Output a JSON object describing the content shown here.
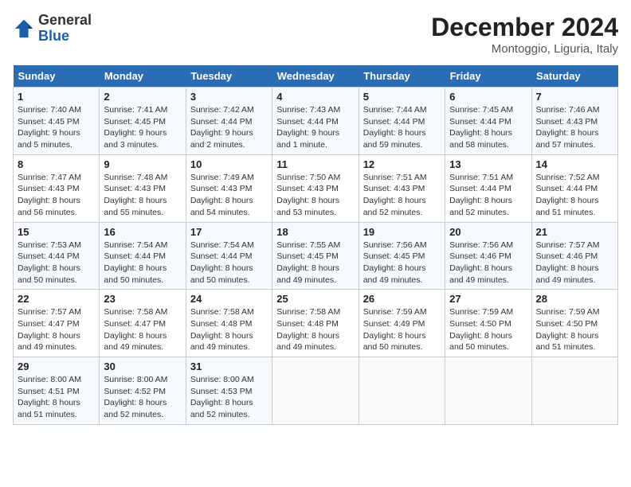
{
  "header": {
    "logo_general": "General",
    "logo_blue": "Blue",
    "month_title": "December 2024",
    "location": "Montoggio, Liguria, Italy"
  },
  "days_of_week": [
    "Sunday",
    "Monday",
    "Tuesday",
    "Wednesday",
    "Thursday",
    "Friday",
    "Saturday"
  ],
  "weeks": [
    [
      {
        "day": "1",
        "sunrise": "Sunrise: 7:40 AM",
        "sunset": "Sunset: 4:45 PM",
        "daylight": "Daylight: 9 hours and 5 minutes."
      },
      {
        "day": "2",
        "sunrise": "Sunrise: 7:41 AM",
        "sunset": "Sunset: 4:45 PM",
        "daylight": "Daylight: 9 hours and 3 minutes."
      },
      {
        "day": "3",
        "sunrise": "Sunrise: 7:42 AM",
        "sunset": "Sunset: 4:44 PM",
        "daylight": "Daylight: 9 hours and 2 minutes."
      },
      {
        "day": "4",
        "sunrise": "Sunrise: 7:43 AM",
        "sunset": "Sunset: 4:44 PM",
        "daylight": "Daylight: 9 hours and 1 minute."
      },
      {
        "day": "5",
        "sunrise": "Sunrise: 7:44 AM",
        "sunset": "Sunset: 4:44 PM",
        "daylight": "Daylight: 8 hours and 59 minutes."
      },
      {
        "day": "6",
        "sunrise": "Sunrise: 7:45 AM",
        "sunset": "Sunset: 4:44 PM",
        "daylight": "Daylight: 8 hours and 58 minutes."
      },
      {
        "day": "7",
        "sunrise": "Sunrise: 7:46 AM",
        "sunset": "Sunset: 4:43 PM",
        "daylight": "Daylight: 8 hours and 57 minutes."
      }
    ],
    [
      {
        "day": "8",
        "sunrise": "Sunrise: 7:47 AM",
        "sunset": "Sunset: 4:43 PM",
        "daylight": "Daylight: 8 hours and 56 minutes."
      },
      {
        "day": "9",
        "sunrise": "Sunrise: 7:48 AM",
        "sunset": "Sunset: 4:43 PM",
        "daylight": "Daylight: 8 hours and 55 minutes."
      },
      {
        "day": "10",
        "sunrise": "Sunrise: 7:49 AM",
        "sunset": "Sunset: 4:43 PM",
        "daylight": "Daylight: 8 hours and 54 minutes."
      },
      {
        "day": "11",
        "sunrise": "Sunrise: 7:50 AM",
        "sunset": "Sunset: 4:43 PM",
        "daylight": "Daylight: 8 hours and 53 minutes."
      },
      {
        "day": "12",
        "sunrise": "Sunrise: 7:51 AM",
        "sunset": "Sunset: 4:43 PM",
        "daylight": "Daylight: 8 hours and 52 minutes."
      },
      {
        "day": "13",
        "sunrise": "Sunrise: 7:51 AM",
        "sunset": "Sunset: 4:44 PM",
        "daylight": "Daylight: 8 hours and 52 minutes."
      },
      {
        "day": "14",
        "sunrise": "Sunrise: 7:52 AM",
        "sunset": "Sunset: 4:44 PM",
        "daylight": "Daylight: 8 hours and 51 minutes."
      }
    ],
    [
      {
        "day": "15",
        "sunrise": "Sunrise: 7:53 AM",
        "sunset": "Sunset: 4:44 PM",
        "daylight": "Daylight: 8 hours and 50 minutes."
      },
      {
        "day": "16",
        "sunrise": "Sunrise: 7:54 AM",
        "sunset": "Sunset: 4:44 PM",
        "daylight": "Daylight: 8 hours and 50 minutes."
      },
      {
        "day": "17",
        "sunrise": "Sunrise: 7:54 AM",
        "sunset": "Sunset: 4:44 PM",
        "daylight": "Daylight: 8 hours and 50 minutes."
      },
      {
        "day": "18",
        "sunrise": "Sunrise: 7:55 AM",
        "sunset": "Sunset: 4:45 PM",
        "daylight": "Daylight: 8 hours and 49 minutes."
      },
      {
        "day": "19",
        "sunrise": "Sunrise: 7:56 AM",
        "sunset": "Sunset: 4:45 PM",
        "daylight": "Daylight: 8 hours and 49 minutes."
      },
      {
        "day": "20",
        "sunrise": "Sunrise: 7:56 AM",
        "sunset": "Sunset: 4:46 PM",
        "daylight": "Daylight: 8 hours and 49 minutes."
      },
      {
        "day": "21",
        "sunrise": "Sunrise: 7:57 AM",
        "sunset": "Sunset: 4:46 PM",
        "daylight": "Daylight: 8 hours and 49 minutes."
      }
    ],
    [
      {
        "day": "22",
        "sunrise": "Sunrise: 7:57 AM",
        "sunset": "Sunset: 4:47 PM",
        "daylight": "Daylight: 8 hours and 49 minutes."
      },
      {
        "day": "23",
        "sunrise": "Sunrise: 7:58 AM",
        "sunset": "Sunset: 4:47 PM",
        "daylight": "Daylight: 8 hours and 49 minutes."
      },
      {
        "day": "24",
        "sunrise": "Sunrise: 7:58 AM",
        "sunset": "Sunset: 4:48 PM",
        "daylight": "Daylight: 8 hours and 49 minutes."
      },
      {
        "day": "25",
        "sunrise": "Sunrise: 7:58 AM",
        "sunset": "Sunset: 4:48 PM",
        "daylight": "Daylight: 8 hours and 49 minutes."
      },
      {
        "day": "26",
        "sunrise": "Sunrise: 7:59 AM",
        "sunset": "Sunset: 4:49 PM",
        "daylight": "Daylight: 8 hours and 50 minutes."
      },
      {
        "day": "27",
        "sunrise": "Sunrise: 7:59 AM",
        "sunset": "Sunset: 4:50 PM",
        "daylight": "Daylight: 8 hours and 50 minutes."
      },
      {
        "day": "28",
        "sunrise": "Sunrise: 7:59 AM",
        "sunset": "Sunset: 4:50 PM",
        "daylight": "Daylight: 8 hours and 51 minutes."
      }
    ],
    [
      {
        "day": "29",
        "sunrise": "Sunrise: 8:00 AM",
        "sunset": "Sunset: 4:51 PM",
        "daylight": "Daylight: 8 hours and 51 minutes."
      },
      {
        "day": "30",
        "sunrise": "Sunrise: 8:00 AM",
        "sunset": "Sunset: 4:52 PM",
        "daylight": "Daylight: 8 hours and 52 minutes."
      },
      {
        "day": "31",
        "sunrise": "Sunrise: 8:00 AM",
        "sunset": "Sunset: 4:53 PM",
        "daylight": "Daylight: 8 hours and 52 minutes."
      },
      null,
      null,
      null,
      null
    ]
  ]
}
